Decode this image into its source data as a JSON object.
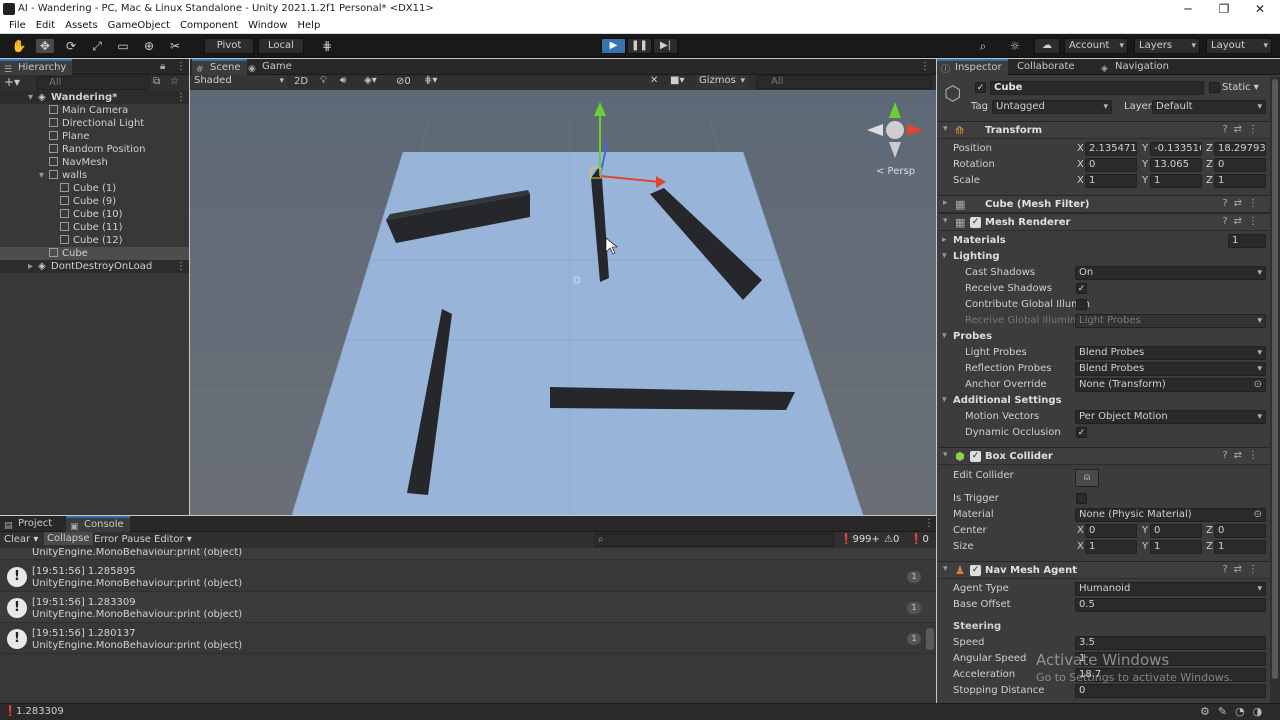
{
  "window": {
    "title": "AI - Wandering - PC, Mac & Linux Standalone - Unity 2021.1.2f1 Personal* <DX11>",
    "minimize": "─",
    "maximize": "❐",
    "close": "✕"
  },
  "menu": [
    "File",
    "Edit",
    "Assets",
    "GameObject",
    "Component",
    "Window",
    "Help"
  ],
  "toolbar": {
    "pivot": "Pivot",
    "local": "Local",
    "account": "Account",
    "layers": "Layers",
    "layout": "Layout"
  },
  "hierarchy": {
    "tab": "Hierarchy",
    "search_placeholder": "All",
    "scene": "Wandering*",
    "items": [
      "Main Camera",
      "Directional Light",
      "Plane",
      "Random Position",
      "NavMesh",
      "walls",
      "Cube (1)",
      "Cube (9)",
      "Cube (10)",
      "Cube (11)",
      "Cube (12)",
      "Cube",
      "DontDestroyOnLoad"
    ]
  },
  "scene": {
    "tab_scene": "Scene",
    "tab_game": "Game",
    "shading": "Shaded",
    "mode_2d": "2D",
    "fx_count": "0",
    "gizmos": "Gizmos",
    "search_placeholder": "All",
    "persp": "< Persp"
  },
  "inspector": {
    "tabs": [
      "Inspector",
      "Collaborate",
      "Navigation"
    ],
    "object_name": "Cube",
    "static": "Static",
    "tag_label": "Tag",
    "tag": "Untagged",
    "layer_label": "Layer",
    "layer": "Default",
    "transform": {
      "title": "Transform",
      "position_label": "Position",
      "position": [
        "2.135471",
        "-0.133516",
        "18.29793"
      ],
      "rotation_label": "Rotation",
      "rotation": [
        "0",
        "13.065",
        "0"
      ],
      "scale_label": "Scale",
      "scale": [
        "1",
        "1",
        "1"
      ]
    },
    "mesh_filter": "Cube (Mesh Filter)",
    "mesh_renderer": {
      "title": "Mesh Renderer",
      "materials": "Materials",
      "materials_count": "1",
      "lighting": "Lighting",
      "cast_shadows": "Cast Shadows",
      "cast_shadows_value": "On",
      "receive_shadows": "Receive Shadows",
      "contribute_gi": "Contribute Global Illumin",
      "receive_gi": "Receive Global Illuminati",
      "receive_gi_value": "Light Probes",
      "probes": "Probes",
      "light_probes": "Light Probes",
      "light_probes_value": "Blend Probes",
      "reflection_probes": "Reflection Probes",
      "reflection_probes_value": "Blend Probes",
      "anchor_override": "Anchor Override",
      "anchor_override_value": "None (Transform)",
      "additional": "Additional Settings",
      "motion_vectors": "Motion Vectors",
      "motion_vectors_value": "Per Object Motion",
      "dynamic_occlusion": "Dynamic Occlusion"
    },
    "box_collider": {
      "title": "Box Collider",
      "edit_collider": "Edit Collider",
      "is_trigger": "Is Trigger",
      "material": "Material",
      "material_value": "None (Physic Material)",
      "center": "Center",
      "center_value": [
        "0",
        "0",
        "0"
      ],
      "size": "Size",
      "size_value": [
        "1",
        "1",
        "1"
      ]
    },
    "nav_agent": {
      "title": "Nav Mesh Agent",
      "agent_type": "Agent Type",
      "agent_type_value": "Humanoid",
      "base_offset": "Base Offset",
      "base_offset_value": "0.5",
      "steering": "Steering",
      "speed": "Speed",
      "speed_value": "3.5",
      "angular_speed": "Angular Speed",
      "angular_speed_value": "1",
      "acceleration": "Acceleration",
      "acceleration_value": "18.7",
      "stopping_distance": "Stopping Distance",
      "stopping_distance_value": "0"
    },
    "watermark_title": "Activate Windows",
    "watermark_sub": "Go to Settings to activate Windows."
  },
  "console": {
    "tab_project": "Project",
    "tab_console": "Console",
    "clear": "Clear",
    "collapse": "Collapse",
    "error_pause": "Error Pause",
    "editor": "Editor",
    "log_count": "999+",
    "warn_count": "0",
    "err_count": "0",
    "partial_line": "UnityEngine.MonoBehaviour:print (object)",
    "entries": [
      {
        "line1": "[19:51:56] 1.285895",
        "line2": "UnityEngine.MonoBehaviour:print (object)",
        "count": "1"
      },
      {
        "line1": "[19:51:56] 1.283309",
        "line2": "UnityEngine.MonoBehaviour:print (object)",
        "count": "1"
      },
      {
        "line1": "[19:51:56] 1.280137",
        "line2": "UnityEngine.MonoBehaviour:print (object)",
        "count": "1"
      }
    ]
  },
  "status": {
    "message": "1.283309"
  }
}
